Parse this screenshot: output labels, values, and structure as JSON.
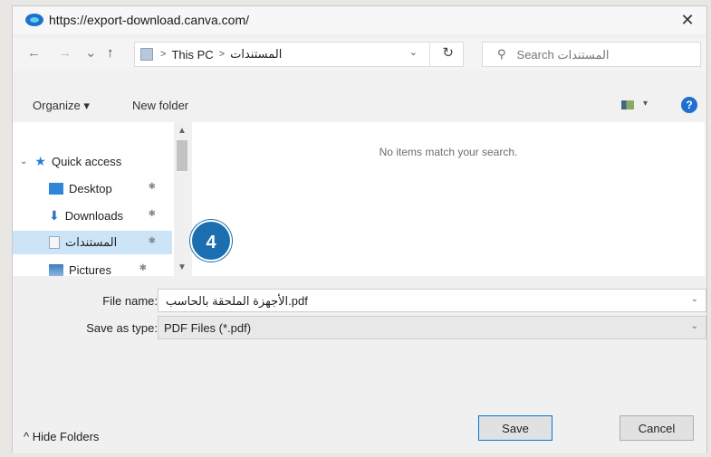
{
  "window": {
    "title": "https://export-download.canva.com/",
    "close_glyph": "✕"
  },
  "nav": {
    "back": "←",
    "forward": "→",
    "recent": "⌄",
    "up": "↑",
    "breadcrumb": [
      "This PC",
      "المستندات"
    ],
    "breadcrumb_sep": ">",
    "refresh": "↻",
    "search_placeholder": "Search المستندات"
  },
  "toolbar": {
    "organize": "Organize ▾",
    "new_folder": "New folder",
    "view_dropdown": "▾",
    "help": "?"
  },
  "sidebar": {
    "items": [
      {
        "label": "Quick access",
        "icon": "star-icon",
        "color": "#2a7ad5"
      },
      {
        "label": "Desktop",
        "icon": "desktop-icon",
        "color": "#2f86d8"
      },
      {
        "label": "Downloads",
        "icon": "download-icon",
        "color": "#2f6fc4"
      },
      {
        "label": "المستندات",
        "icon": "documents-icon",
        "color": "#9aa7b3"
      },
      {
        "label": "Pictures",
        "icon": "pictures-icon",
        "color": "#3a7bbf"
      }
    ],
    "pin_glyph": "✱"
  },
  "content": {
    "empty_message": "No items match your search."
  },
  "badge": {
    "number": "4",
    "color": "#1b6fb0"
  },
  "form": {
    "file_name_label": "File name:",
    "file_name_value": "الأجهزة الملحقة بالحاسب.pdf",
    "save_type_label": "Save as type:",
    "save_type_value": "PDF Files (*.pdf)"
  },
  "footer": {
    "hide_folders": "^ Hide Folders",
    "save": "Save",
    "cancel": "Cancel"
  }
}
